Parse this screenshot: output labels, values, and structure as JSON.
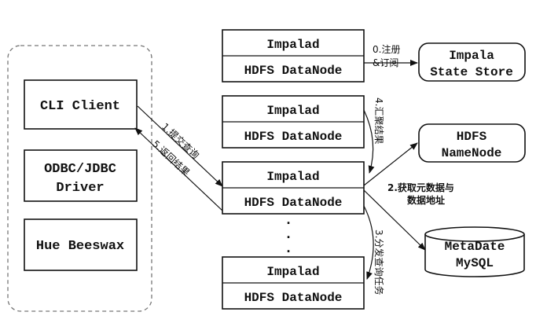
{
  "clients": {
    "cli": "CLI Client",
    "odbc_line1": "ODBC/JDBC",
    "odbc_line2": "Driver",
    "hue": "Hue Beeswax"
  },
  "nodes": {
    "impalad": "Impalad",
    "datanode": "HDFS DataNode",
    "ellipsis": "."
  },
  "services": {
    "state_store_line1": "Impala",
    "state_store_line2": "State Store",
    "namenode_line1": "HDFS",
    "namenode_line2": "NameNode",
    "metadata_line1": "MetaDate",
    "metadata_line2": "MySQL"
  },
  "edges": {
    "register_line1": "0.注册",
    "register_line2": "&订阅",
    "submit_query": "1.提交查询",
    "return_result": "5.返回结果",
    "fetch_meta_line1": "2.获取元数据与",
    "fetch_meta_line2": "数据地址",
    "distribute_task": "3.分发查询任务",
    "aggregate_result": "4.汇聚结果"
  }
}
